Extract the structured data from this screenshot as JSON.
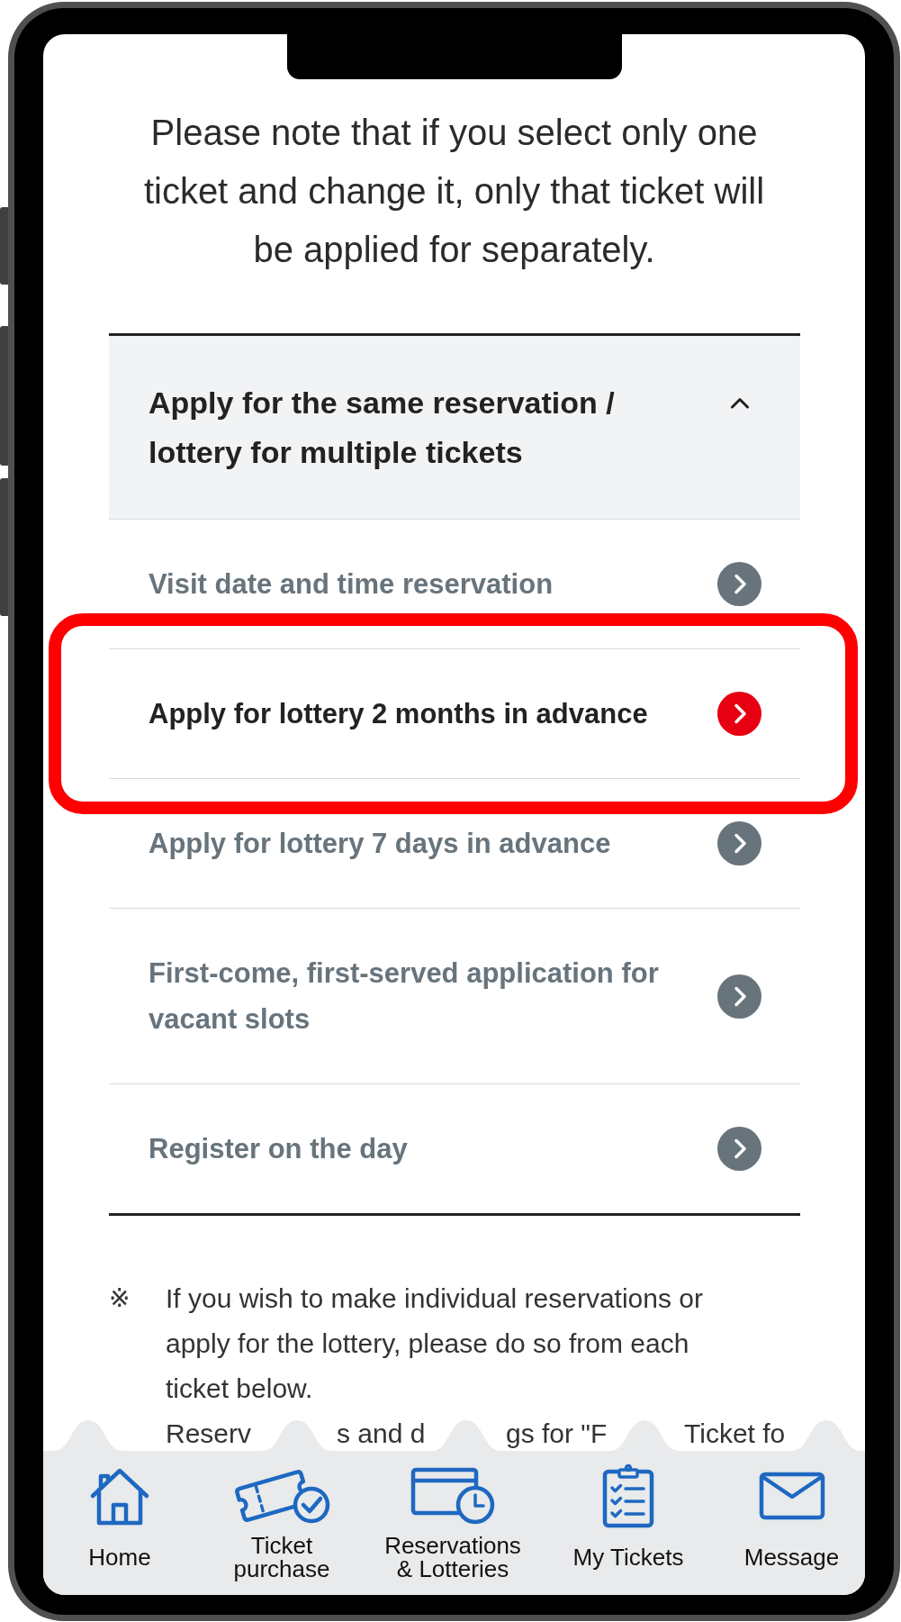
{
  "notice": "Please note that if you select only one ticket and change it, only that ticket will be applied for separately.",
  "accordion": {
    "title": "Apply for the same reservation / lottery for multiple tickets",
    "expanded": true,
    "items": [
      {
        "label": "Visit date and time reservation",
        "selected": false
      },
      {
        "label": "Apply for lottery 2 months in advance",
        "selected": true
      },
      {
        "label": "Apply for lottery 7 days in advance",
        "selected": false
      },
      {
        "label": "First-come, first-served application for vacant slots",
        "selected": false
      },
      {
        "label": "Register on the day",
        "selected": false
      }
    ]
  },
  "note": {
    "mark": "※",
    "text": "If you wish to make individual reservations or apply for the lottery, please do so from each ticket below.",
    "covered_line_fragments": [
      "Reserv",
      "s and d",
      "gs for \"F",
      "Ticket fo"
    ]
  },
  "bottom_nav": {
    "items": [
      {
        "label": "Home"
      },
      {
        "label": "Ticket purchase"
      },
      {
        "label": "Reservations & Lotteries"
      },
      {
        "label": "My Tickets"
      },
      {
        "label": "Message"
      }
    ]
  }
}
